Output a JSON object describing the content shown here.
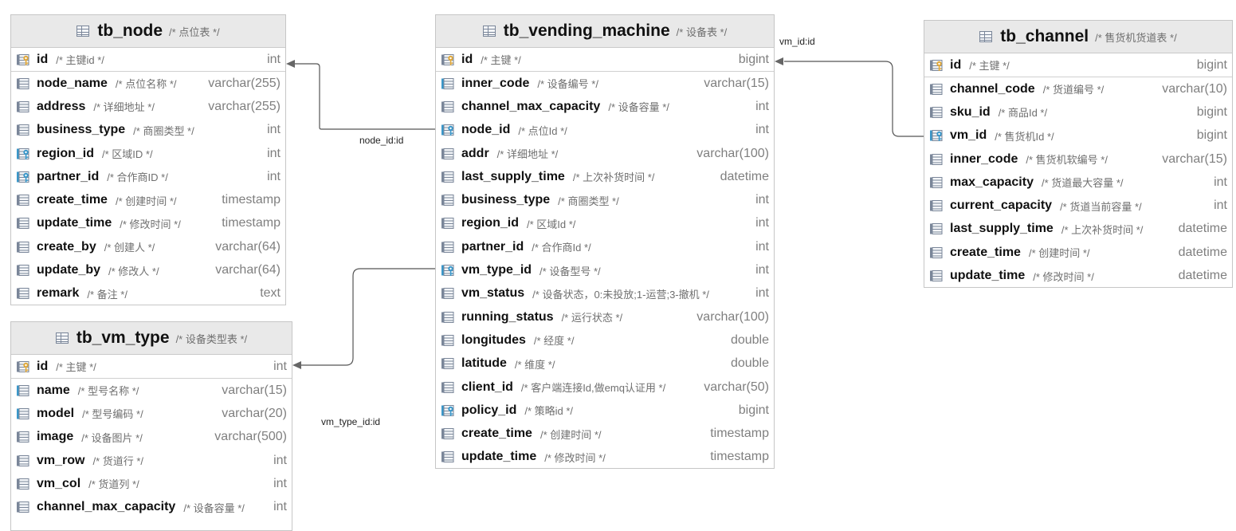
{
  "tables": {
    "tb_node": {
      "name": "tb_node",
      "comment": "/* 点位表 */",
      "columns": [
        {
          "name": "id",
          "comment": "/* 主键id */",
          "type": "int",
          "icon": "primary-key-icon"
        },
        {
          "name": "node_name",
          "comment": "/* 点位名称 */",
          "type": "varchar(255)",
          "icon": "column-icon"
        },
        {
          "name": "address",
          "comment": "/* 详细地址 */",
          "type": "varchar(255)",
          "icon": "column-icon"
        },
        {
          "name": "business_type",
          "comment": "/* 商圈类型 */",
          "type": "int",
          "icon": "column-icon"
        },
        {
          "name": "region_id",
          "comment": "/* 区域ID */",
          "type": "int",
          "icon": "foreign-key-icon"
        },
        {
          "name": "partner_id",
          "comment": "/* 合作商ID */",
          "type": "int",
          "icon": "foreign-key-icon"
        },
        {
          "name": "create_time",
          "comment": "/* 创建时间 */",
          "type": "timestamp",
          "icon": "column-icon"
        },
        {
          "name": "update_time",
          "comment": "/* 修改时间 */",
          "type": "timestamp",
          "icon": "column-icon"
        },
        {
          "name": "create_by",
          "comment": "/* 创建人 */",
          "type": "varchar(64)",
          "icon": "column-icon"
        },
        {
          "name": "update_by",
          "comment": "/* 修改人 */",
          "type": "varchar(64)",
          "icon": "column-icon"
        },
        {
          "name": "remark",
          "comment": "/* 备注 */",
          "type": "text",
          "icon": "column-icon"
        }
      ]
    },
    "tb_vm_type": {
      "name": "tb_vm_type",
      "comment": "/* 设备类型表 */",
      "columns": [
        {
          "name": "id",
          "comment": "/* 主键 */",
          "type": "int",
          "icon": "primary-key-icon"
        },
        {
          "name": "name",
          "comment": "/* 型号名称 */",
          "type": "varchar(15)",
          "icon": "indexed-column-icon"
        },
        {
          "name": "model",
          "comment": "/* 型号编码 */",
          "type": "varchar(20)",
          "icon": "indexed-column-icon"
        },
        {
          "name": "image",
          "comment": "/* 设备图片 */",
          "type": "varchar(500)",
          "icon": "column-icon"
        },
        {
          "name": "vm_row",
          "comment": "/* 货道行 */",
          "type": "int",
          "icon": "column-icon"
        },
        {
          "name": "vm_col",
          "comment": "/* 货道列 */",
          "type": "int",
          "icon": "column-icon"
        },
        {
          "name": "channel_max_capacity",
          "comment": "/* 设备容量 */",
          "type": "int",
          "icon": "column-icon"
        }
      ]
    },
    "tb_vending_machine": {
      "name": "tb_vending_machine",
      "comment": "/* 设备表 */",
      "columns": [
        {
          "name": "id",
          "comment": "/* 主键 */",
          "type": "bigint",
          "icon": "primary-key-icon"
        },
        {
          "name": "inner_code",
          "comment": "/* 设备编号 */",
          "type": "varchar(15)",
          "icon": "indexed-column-icon"
        },
        {
          "name": "channel_max_capacity",
          "comment": "/* 设备容量 */",
          "type": "int",
          "icon": "column-icon"
        },
        {
          "name": "node_id",
          "comment": "/* 点位Id */",
          "type": "int",
          "icon": "foreign-key-icon"
        },
        {
          "name": "addr",
          "comment": "/* 详细地址 */",
          "type": "varchar(100)",
          "icon": "column-icon"
        },
        {
          "name": "last_supply_time",
          "comment": "/* 上次补货时间 */",
          "type": "datetime",
          "icon": "column-icon"
        },
        {
          "name": "business_type",
          "comment": "/* 商圈类型 */",
          "type": "int",
          "icon": "column-icon"
        },
        {
          "name": "region_id",
          "comment": "/* 区域Id */",
          "type": "int",
          "icon": "column-icon"
        },
        {
          "name": "partner_id",
          "comment": "/* 合作商Id */",
          "type": "int",
          "icon": "column-icon"
        },
        {
          "name": "vm_type_id",
          "comment": "/* 设备型号 */",
          "type": "int",
          "icon": "foreign-key-icon"
        },
        {
          "name": "vm_status",
          "comment": "/* 设备状态，0:未投放;1-运营;3-撤机 */",
          "type": "int",
          "icon": "column-icon"
        },
        {
          "name": "running_status",
          "comment": "/* 运行状态 */",
          "type": "varchar(100)",
          "icon": "column-icon"
        },
        {
          "name": "longitudes",
          "comment": "/* 经度 */",
          "type": "double",
          "icon": "column-icon"
        },
        {
          "name": "latitude",
          "comment": "/* 维度 */",
          "type": "double",
          "icon": "column-icon"
        },
        {
          "name": "client_id",
          "comment": "/* 客户端连接Id,做emq认证用 */",
          "type": "varchar(50)",
          "icon": "column-icon"
        },
        {
          "name": "policy_id",
          "comment": "/* 策略id */",
          "type": "bigint",
          "icon": "foreign-key-icon"
        },
        {
          "name": "create_time",
          "comment": "/* 创建时间 */",
          "type": "timestamp",
          "icon": "column-icon"
        },
        {
          "name": "update_time",
          "comment": "/* 修改时间 */",
          "type": "timestamp",
          "icon": "column-icon"
        }
      ]
    },
    "tb_channel": {
      "name": "tb_channel",
      "comment": "/* 售货机货道表 */",
      "columns": [
        {
          "name": "id",
          "comment": "/* 主键 */",
          "type": "bigint",
          "icon": "primary-key-icon"
        },
        {
          "name": "channel_code",
          "comment": "/* 货道编号 */",
          "type": "varchar(10)",
          "icon": "column-icon"
        },
        {
          "name": "sku_id",
          "comment": "/* 商品Id */",
          "type": "bigint",
          "icon": "column-icon"
        },
        {
          "name": "vm_id",
          "comment": "/* 售货机Id */",
          "type": "bigint",
          "icon": "foreign-key-icon"
        },
        {
          "name": "inner_code",
          "comment": "/* 售货机软编号 */",
          "type": "varchar(15)",
          "icon": "column-icon"
        },
        {
          "name": "max_capacity",
          "comment": "/* 货道最大容量 */",
          "type": "int",
          "icon": "column-icon"
        },
        {
          "name": "current_capacity",
          "comment": "/* 货道当前容量 */",
          "type": "int",
          "icon": "column-icon"
        },
        {
          "name": "last_supply_time",
          "comment": "/* 上次补货时间 */",
          "type": "datetime",
          "icon": "column-icon"
        },
        {
          "name": "create_time",
          "comment": "/* 创建时间 */",
          "type": "datetime",
          "icon": "column-icon"
        },
        {
          "name": "update_time",
          "comment": "/* 修改时间 */",
          "type": "datetime",
          "icon": "column-icon"
        }
      ]
    }
  },
  "relations": [
    {
      "label": "node_id:id",
      "from_table": "tb_vending_machine",
      "from_column": "node_id",
      "to_table": "tb_node",
      "to_column": "id"
    },
    {
      "label": "vm_type_id:id",
      "from_table": "tb_vending_machine",
      "from_column": "vm_type_id",
      "to_table": "tb_vm_type",
      "to_column": "id"
    },
    {
      "label": "vm_id:id",
      "from_table": "tb_channel",
      "from_column": "vm_id",
      "to_table": "tb_vending_machine",
      "to_column": "id"
    }
  ],
  "colors": {
    "header_bg": "#e9e9e9",
    "border": "#c6c6c6",
    "key_gold": "#e0a83a",
    "fk_blue": "#3a97c9",
    "column_gray": "#7a8699",
    "connector": "#555555"
  }
}
